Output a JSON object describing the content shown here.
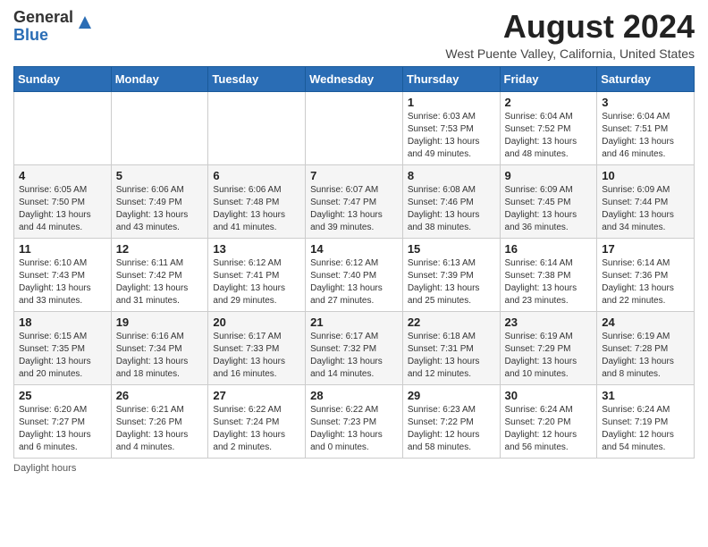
{
  "header": {
    "logo_general": "General",
    "logo_blue": "Blue",
    "month_title": "August 2024",
    "location": "West Puente Valley, California, United States"
  },
  "days_of_week": [
    "Sunday",
    "Monday",
    "Tuesday",
    "Wednesday",
    "Thursday",
    "Friday",
    "Saturday"
  ],
  "weeks": [
    [
      {
        "day": "",
        "info": ""
      },
      {
        "day": "",
        "info": ""
      },
      {
        "day": "",
        "info": ""
      },
      {
        "day": "",
        "info": ""
      },
      {
        "day": "1",
        "info": "Sunrise: 6:03 AM\nSunset: 7:53 PM\nDaylight: 13 hours and 49 minutes."
      },
      {
        "day": "2",
        "info": "Sunrise: 6:04 AM\nSunset: 7:52 PM\nDaylight: 13 hours and 48 minutes."
      },
      {
        "day": "3",
        "info": "Sunrise: 6:04 AM\nSunset: 7:51 PM\nDaylight: 13 hours and 46 minutes."
      }
    ],
    [
      {
        "day": "4",
        "info": "Sunrise: 6:05 AM\nSunset: 7:50 PM\nDaylight: 13 hours and 44 minutes."
      },
      {
        "day": "5",
        "info": "Sunrise: 6:06 AM\nSunset: 7:49 PM\nDaylight: 13 hours and 43 minutes."
      },
      {
        "day": "6",
        "info": "Sunrise: 6:06 AM\nSunset: 7:48 PM\nDaylight: 13 hours and 41 minutes."
      },
      {
        "day": "7",
        "info": "Sunrise: 6:07 AM\nSunset: 7:47 PM\nDaylight: 13 hours and 39 minutes."
      },
      {
        "day": "8",
        "info": "Sunrise: 6:08 AM\nSunset: 7:46 PM\nDaylight: 13 hours and 38 minutes."
      },
      {
        "day": "9",
        "info": "Sunrise: 6:09 AM\nSunset: 7:45 PM\nDaylight: 13 hours and 36 minutes."
      },
      {
        "day": "10",
        "info": "Sunrise: 6:09 AM\nSunset: 7:44 PM\nDaylight: 13 hours and 34 minutes."
      }
    ],
    [
      {
        "day": "11",
        "info": "Sunrise: 6:10 AM\nSunset: 7:43 PM\nDaylight: 13 hours and 33 minutes."
      },
      {
        "day": "12",
        "info": "Sunrise: 6:11 AM\nSunset: 7:42 PM\nDaylight: 13 hours and 31 minutes."
      },
      {
        "day": "13",
        "info": "Sunrise: 6:12 AM\nSunset: 7:41 PM\nDaylight: 13 hours and 29 minutes."
      },
      {
        "day": "14",
        "info": "Sunrise: 6:12 AM\nSunset: 7:40 PM\nDaylight: 13 hours and 27 minutes."
      },
      {
        "day": "15",
        "info": "Sunrise: 6:13 AM\nSunset: 7:39 PM\nDaylight: 13 hours and 25 minutes."
      },
      {
        "day": "16",
        "info": "Sunrise: 6:14 AM\nSunset: 7:38 PM\nDaylight: 13 hours and 23 minutes."
      },
      {
        "day": "17",
        "info": "Sunrise: 6:14 AM\nSunset: 7:36 PM\nDaylight: 13 hours and 22 minutes."
      }
    ],
    [
      {
        "day": "18",
        "info": "Sunrise: 6:15 AM\nSunset: 7:35 PM\nDaylight: 13 hours and 20 minutes."
      },
      {
        "day": "19",
        "info": "Sunrise: 6:16 AM\nSunset: 7:34 PM\nDaylight: 13 hours and 18 minutes."
      },
      {
        "day": "20",
        "info": "Sunrise: 6:17 AM\nSunset: 7:33 PM\nDaylight: 13 hours and 16 minutes."
      },
      {
        "day": "21",
        "info": "Sunrise: 6:17 AM\nSunset: 7:32 PM\nDaylight: 13 hours and 14 minutes."
      },
      {
        "day": "22",
        "info": "Sunrise: 6:18 AM\nSunset: 7:31 PM\nDaylight: 13 hours and 12 minutes."
      },
      {
        "day": "23",
        "info": "Sunrise: 6:19 AM\nSunset: 7:29 PM\nDaylight: 13 hours and 10 minutes."
      },
      {
        "day": "24",
        "info": "Sunrise: 6:19 AM\nSunset: 7:28 PM\nDaylight: 13 hours and 8 minutes."
      }
    ],
    [
      {
        "day": "25",
        "info": "Sunrise: 6:20 AM\nSunset: 7:27 PM\nDaylight: 13 hours and 6 minutes."
      },
      {
        "day": "26",
        "info": "Sunrise: 6:21 AM\nSunset: 7:26 PM\nDaylight: 13 hours and 4 minutes."
      },
      {
        "day": "27",
        "info": "Sunrise: 6:22 AM\nSunset: 7:24 PM\nDaylight: 13 hours and 2 minutes."
      },
      {
        "day": "28",
        "info": "Sunrise: 6:22 AM\nSunset: 7:23 PM\nDaylight: 13 hours and 0 minutes."
      },
      {
        "day": "29",
        "info": "Sunrise: 6:23 AM\nSunset: 7:22 PM\nDaylight: 12 hours and 58 minutes."
      },
      {
        "day": "30",
        "info": "Sunrise: 6:24 AM\nSunset: 7:20 PM\nDaylight: 12 hours and 56 minutes."
      },
      {
        "day": "31",
        "info": "Sunrise: 6:24 AM\nSunset: 7:19 PM\nDaylight: 12 hours and 54 minutes."
      }
    ]
  ],
  "footer": {
    "daylight_hours_label": "Daylight hours"
  }
}
